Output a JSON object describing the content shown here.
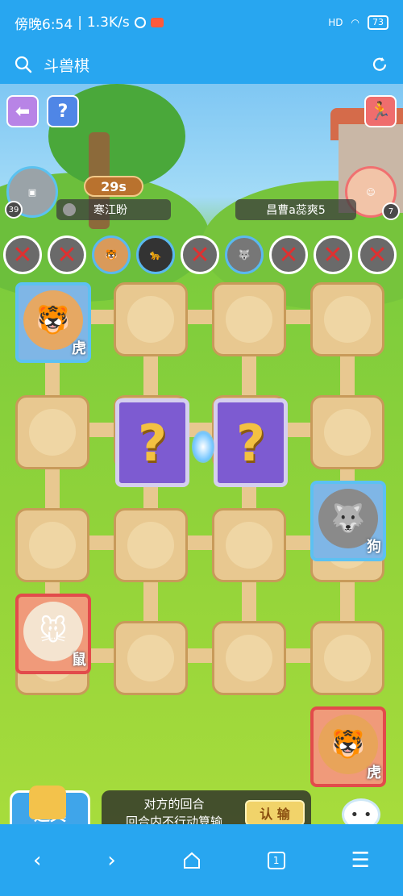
{
  "status_bar": {
    "time_text": "傍晚6:54",
    "speed": "1.3K/s",
    "network": "HD",
    "battery": "73"
  },
  "header": {
    "title": "斗兽棋"
  },
  "game": {
    "timer": "29s",
    "players": {
      "me": {
        "name": "寒江盼",
        "level": "39"
      },
      "opponent": {
        "name": "昌曹a蕊爽5",
        "level": "7"
      }
    },
    "help_label": "?",
    "captured": [
      {
        "state": "eliminated",
        "animal": ""
      },
      {
        "state": "eliminated",
        "animal": ""
      },
      {
        "state": "alive",
        "animal": "tiger"
      },
      {
        "state": "alive",
        "animal": "panther"
      },
      {
        "state": "eliminated",
        "animal": ""
      },
      {
        "state": "alive",
        "animal": "wolf"
      },
      {
        "state": "eliminated",
        "animal": ""
      },
      {
        "state": "eliminated",
        "animal": ""
      },
      {
        "state": "eliminated",
        "animal": ""
      }
    ],
    "cross_mark": "✕",
    "pieces": {
      "tiger_blue": {
        "label": "虎",
        "icon": "tiger-icon"
      },
      "dog_blue": {
        "label": "狗",
        "icon": "dog-icon"
      },
      "rat_red": {
        "label": "鼠",
        "icon": "rat-icon"
      },
      "tiger_red": {
        "label": "虎",
        "icon": "tiger-icon"
      }
    },
    "hidden_mark": "?",
    "props_label": "道具",
    "message_line1": "对方的回合",
    "message_line2": "回合内不行动算输",
    "surrender_label": "认 输"
  },
  "navbar": {
    "tab_count": "1"
  },
  "colors": {
    "accent": "#28a6f0",
    "red_side": "#e24b4b",
    "blue_side": "#5cc1f2",
    "hidden_card": "#7d5bd1"
  }
}
